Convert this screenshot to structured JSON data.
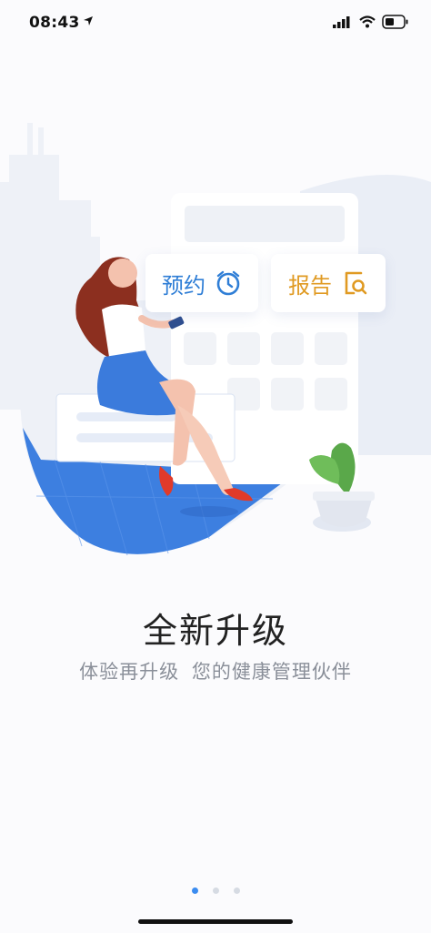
{
  "status_bar": {
    "time": "08:43"
  },
  "illustration": {
    "chip_booking": {
      "label": "预约",
      "icon": "alarm-clock-icon",
      "color": "#2f7ed6"
    },
    "chip_report": {
      "label": "报告",
      "icon": "report-search-icon",
      "color": "#e09a22"
    }
  },
  "intro": {
    "title": "全新升级",
    "subtitle": "体验再升级 您的健康管理伙伴"
  },
  "pager": {
    "active_index": 1,
    "total": 3
  },
  "colors": {
    "accent": "#3b8cf0",
    "illustration_blue": "#3d7fe0",
    "background": "#fbfbfd"
  }
}
